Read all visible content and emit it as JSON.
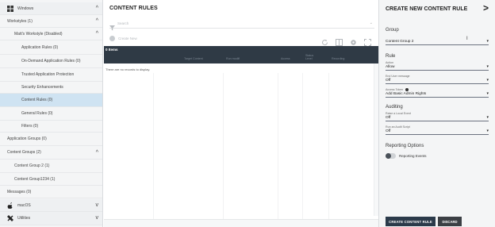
{
  "sidebar": {
    "items": [
      {
        "label": "Windows",
        "caret": "^"
      },
      {
        "label": "Workstyles (1)",
        "caret": "^"
      },
      {
        "label": "Matt's Workstyle (Disabled)",
        "caret": "^"
      },
      {
        "label": "Application Rules (0)",
        "caret": ""
      },
      {
        "label": "On-Demand Application Rules (0)",
        "caret": ""
      },
      {
        "label": "Trusted Application Protection",
        "caret": ""
      },
      {
        "label": "Security Enhancements",
        "caret": ""
      },
      {
        "label": "Content Rules (0)",
        "caret": ""
      },
      {
        "label": "General Rules (0)",
        "caret": ""
      },
      {
        "label": "Filters (0)",
        "caret": ""
      },
      {
        "label": "Application Groups (0)",
        "caret": ""
      },
      {
        "label": "Content Groups (2)",
        "caret": "^"
      },
      {
        "label": "Content Group 2 (1)",
        "caret": ""
      },
      {
        "label": "Content Group1234 (1)",
        "caret": ""
      },
      {
        "label": "Messages (0)",
        "caret": ""
      },
      {
        "label": "macOS",
        "caret": "v"
      },
      {
        "label": "Utilities",
        "caret": "v"
      }
    ]
  },
  "main": {
    "title": "CONTENT RULES",
    "filter_placeholder": "Search",
    "create_label": "Create New",
    "items_count": "0 Items",
    "columns": [
      "Target Content",
      "Run modifi",
      "Access",
      "Status Level",
      "Recording"
    ],
    "no_records": "There are no records to display."
  },
  "panel": {
    "title": "CREATE NEW CONTENT RULE",
    "arrow": ">",
    "group_heading": "Group",
    "group_value": "Content Group 2",
    "rule_heading": "Rule",
    "action_label": "Action",
    "action_value": "Allow",
    "end_user_message_label": "End User message",
    "end_user_message_value": "Off",
    "access_token_label": "Access Token",
    "access_token_value": "Add Basic Admin Rights",
    "auditing_heading": "Auditing",
    "raise_event_label": "Raise a Local Event",
    "raise_event_value": "Off",
    "run_audit_label": "Run an Audit Script",
    "run_audit_value": "Off",
    "reporting_heading": "Reporting Options",
    "reporting_events_label": "Reporting Events",
    "create_button": "CREATE CONTENT RULE",
    "discard_button": "DISCARD"
  },
  "colors": {
    "header_dark": "#2f3a45",
    "active_row": "#cfe3f2",
    "create_button": "#2b3a4a"
  }
}
